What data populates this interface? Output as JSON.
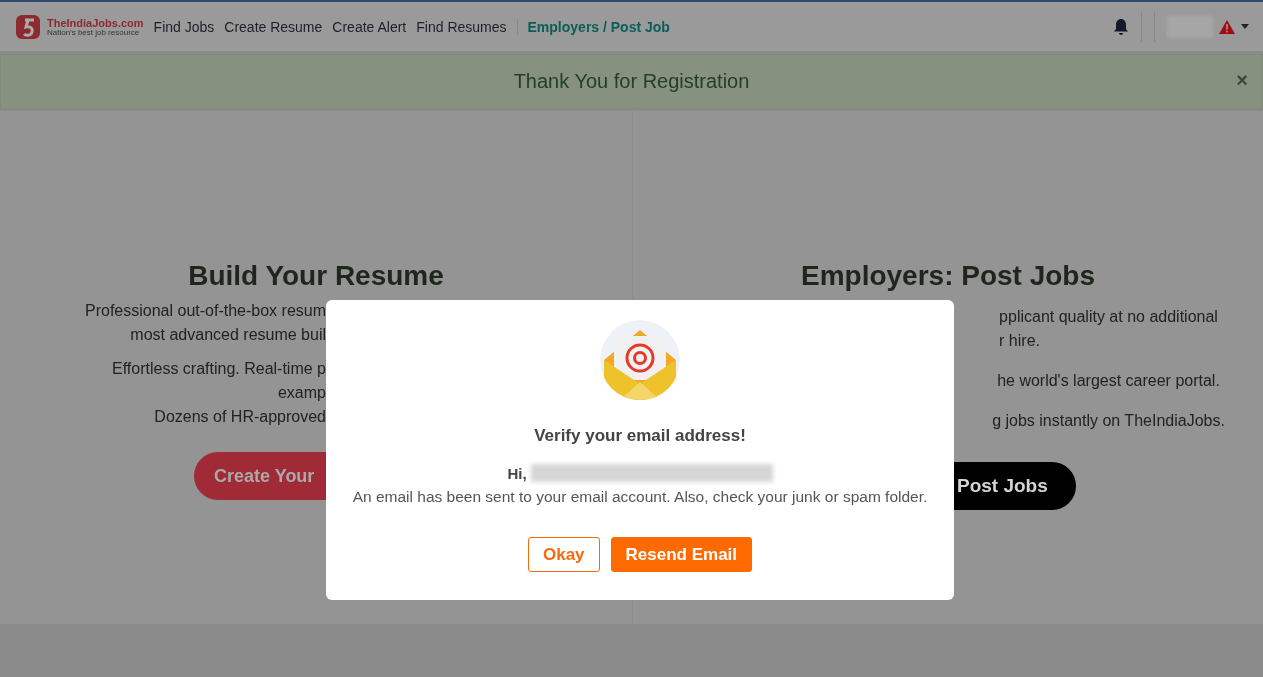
{
  "navbar": {
    "logo": {
      "name": "TheIndiaJobs.com",
      "tagline": "Nation's best job resource"
    },
    "links": [
      {
        "label": "Find Jobs",
        "selected": false
      },
      {
        "label": "Create Resume",
        "selected": false
      },
      {
        "label": "Create Alert",
        "selected": false
      },
      {
        "label": "Find Resumes",
        "selected": false
      },
      {
        "label": "Employers / Post Job",
        "selected": true
      }
    ]
  },
  "alert": {
    "message": "Thank You for Registration",
    "close": "×"
  },
  "panels": [
    {
      "kind": "left",
      "title": "Build Your Resume",
      "paragraphs": [
        [
          "Professional out-of-the-box resum",
          "most advanced resume buil"
        ],
        [
          "Effortless crafting. Real-time p",
          "examp",
          "Dozens of HR-approved"
        ]
      ],
      "button": "Create Your"
    },
    {
      "kind": "right",
      "title": "Employers: Post Jobs",
      "paragraphs": [
        [
          "pplicant quality at no additional",
          "r hire."
        ],
        [
          "he world's largest career portal."
        ],
        [
          "g jobs instantly on TheIndiaJobs."
        ]
      ],
      "button": "Post Jobs"
    }
  ],
  "modal": {
    "title": "Verify your email address!",
    "greeting": "Hi,",
    "message": "An email has been sent to your email account. Also, check your junk or spam folder.",
    "buttons": [
      {
        "label": "Okay",
        "kind": "outline"
      },
      {
        "label": "Resend Email",
        "kind": "solid"
      }
    ]
  }
}
